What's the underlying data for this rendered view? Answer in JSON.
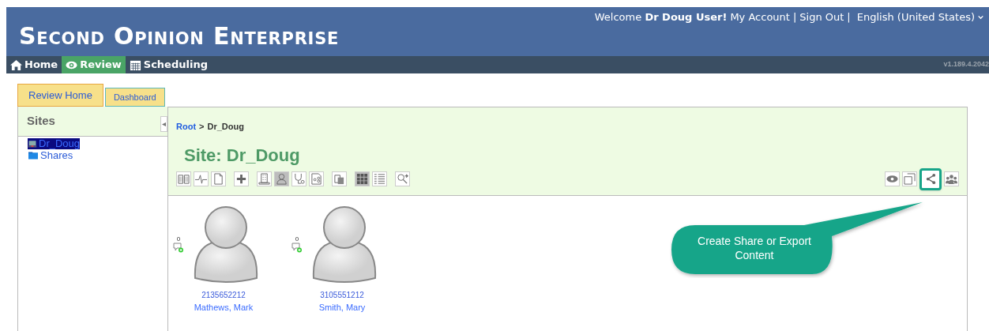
{
  "header": {
    "title": "Second Opinion Enterprise",
    "welcome": "Welcome **Dr Doug User!**",
    "links": [
      "My Account",
      "Sign Out"
    ],
    "separator": "|",
    "language": "English (United States)",
    "version": "v1.189.4.2042"
  },
  "nav": [
    {
      "kind": "home",
      "label": "Home",
      "selected": false
    },
    {
      "kind": "eye",
      "label": "Review",
      "selected": true
    },
    {
      "kind": "calendar",
      "label": "Scheduling",
      "selected": false
    }
  ],
  "tabs": [
    {
      "label": "Review Home",
      "selected": true
    },
    {
      "label": "Dashboard",
      "selected": false
    }
  ],
  "sidebar": {
    "title": "Sites",
    "items": [
      {
        "kind": "site",
        "label": "Dr_Doug",
        "selected": true
      },
      {
        "kind": "folder",
        "label": "Shares",
        "selected": false
      }
    ]
  },
  "breadcrumb": {
    "root": "Root",
    "separator": ">",
    "current": "Dr_Doug"
  },
  "site_title": "Site: Dr_Doug",
  "toolbar": [
    [
      {
        "kind": "book",
        "selected": false
      },
      {
        "kind": "pulse",
        "selected": false
      },
      {
        "kind": "page",
        "selected": false
      }
    ],
    [
      {
        "kind": "plus",
        "selected": false
      }
    ],
    [
      {
        "kind": "building",
        "selected": false
      },
      {
        "kind": "person",
        "selected": true
      },
      {
        "kind": "stethoscope",
        "selected": false
      },
      {
        "kind": "doc-share",
        "selected": false
      }
    ],
    [
      {
        "kind": "copy",
        "selected": false
      }
    ],
    [
      {
        "kind": "grid",
        "selected": true
      },
      {
        "kind": "list",
        "selected": false
      }
    ],
    [
      {
        "kind": "search",
        "selected": false
      }
    ]
  ],
  "right_tools": [
    {
      "kind": "eye",
      "highlighted": false
    },
    {
      "kind": "window",
      "highlighted": false
    },
    {
      "kind": "share",
      "highlighted": true
    },
    {
      "kind": "group",
      "highlighted": false
    }
  ],
  "patients": [
    {
      "comments": "0",
      "id": "2135652212",
      "name": "Mathews, Mark"
    },
    {
      "comments": "0",
      "id": "3105551212",
      "name": "Smith, Mary"
    }
  ],
  "callout": "Create Share or Export Content"
}
